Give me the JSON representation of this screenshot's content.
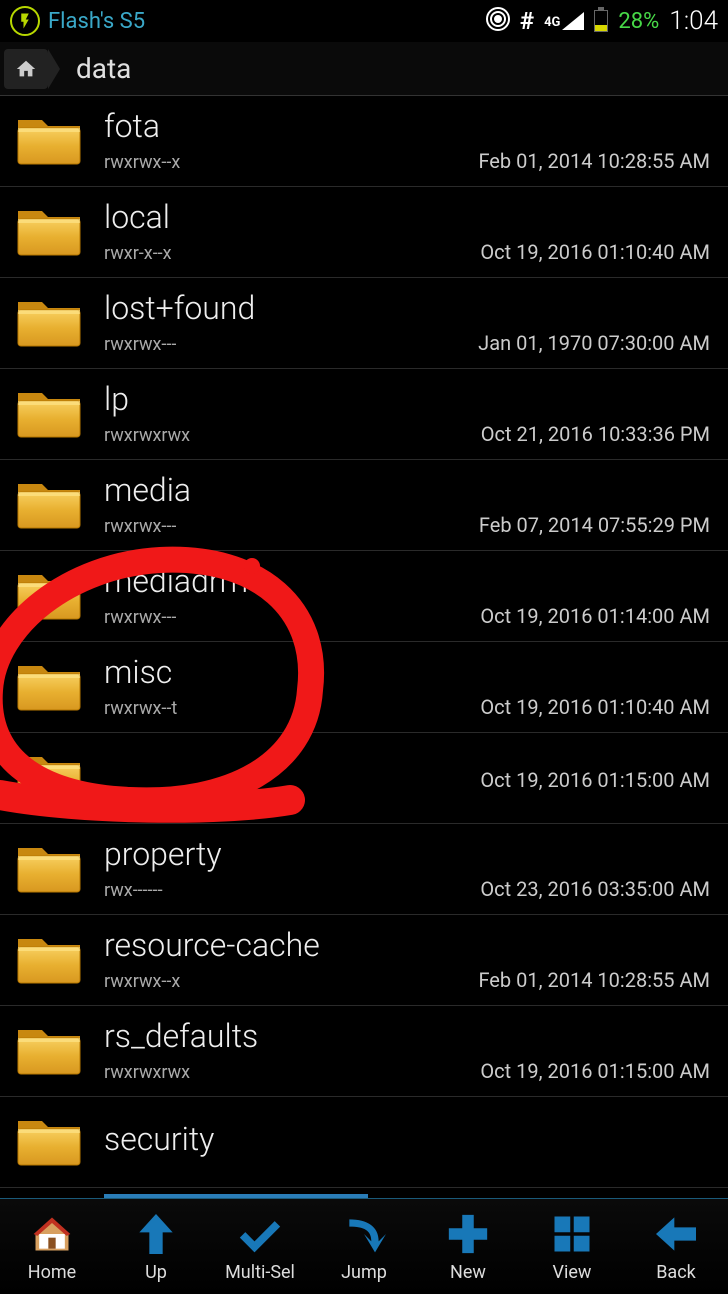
{
  "status": {
    "device": "Flash's S5",
    "battery_pct": "28%",
    "time": "1:04",
    "net": "4G"
  },
  "breadcrumb": {
    "path": "data"
  },
  "files": [
    {
      "name": "fota",
      "perms": "rwxrwx--x",
      "date": "Feb 01, 2014 10:28:55 AM"
    },
    {
      "name": "local",
      "perms": "rwxr-x--x",
      "date": "Oct 19, 2016 01:10:40 AM"
    },
    {
      "name": "lost+found",
      "perms": "rwxrwx---",
      "date": "Jan 01, 1970 07:30:00 AM"
    },
    {
      "name": "lp",
      "perms": "rwxrwxrwx",
      "date": "Oct 21, 2016 10:33:36 PM"
    },
    {
      "name": "media",
      "perms": "rwxrwx---",
      "date": "Feb 07, 2014 07:55:29 PM"
    },
    {
      "name": "mediadrm",
      "perms": "rwxrwx---",
      "date": "Oct 19, 2016 01:14:00 AM"
    },
    {
      "name": "misc",
      "perms": "rwxrwx--t",
      "date": "Oct 19, 2016 01:10:40 AM"
    },
    {
      "name": "",
      "perms": "",
      "date": "Oct 19, 2016 01:15:00 AM"
    },
    {
      "name": "property",
      "perms": "rwx------",
      "date": "Oct 23, 2016 03:35:00 AM"
    },
    {
      "name": "resource-cache",
      "perms": "rwxrwx--x",
      "date": "Feb 01, 2014 10:28:55 AM"
    },
    {
      "name": "rs_defaults",
      "perms": "rwxrwxrwx",
      "date": "Oct 19, 2016 01:15:00 AM"
    },
    {
      "name": "security",
      "perms": "",
      "date": ""
    }
  ],
  "toolbar": {
    "home": "Home",
    "up": "Up",
    "multisel": "Multi-Sel",
    "jump": "Jump",
    "new": "New",
    "view": "View",
    "back": "Back"
  }
}
